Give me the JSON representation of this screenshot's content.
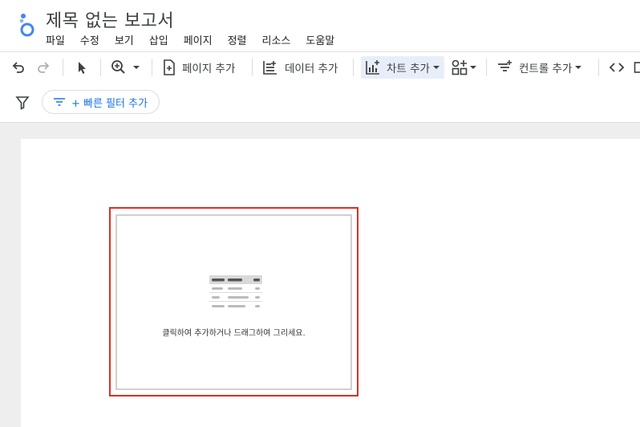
{
  "report": {
    "title": "제목 없는 보고서"
  },
  "menu": [
    "파일",
    "수정",
    "보기",
    "삽입",
    "페이지",
    "정렬",
    "리소스",
    "도움말"
  ],
  "toolbar": {
    "add_page": "페이지 추가",
    "add_data": "데이터 추가",
    "add_chart": "차트 추가",
    "add_control": "컨트롤 추가"
  },
  "filter": {
    "quick_filter": "+ 빠른 필터 추가"
  },
  "canvas": {
    "placeholder_hint": "클릭하여 추가하거나 드래그하여 그리세요."
  },
  "colors": {
    "accent": "#1a73e8",
    "selection": "#d93025",
    "active_bg": "#e8eef9"
  }
}
